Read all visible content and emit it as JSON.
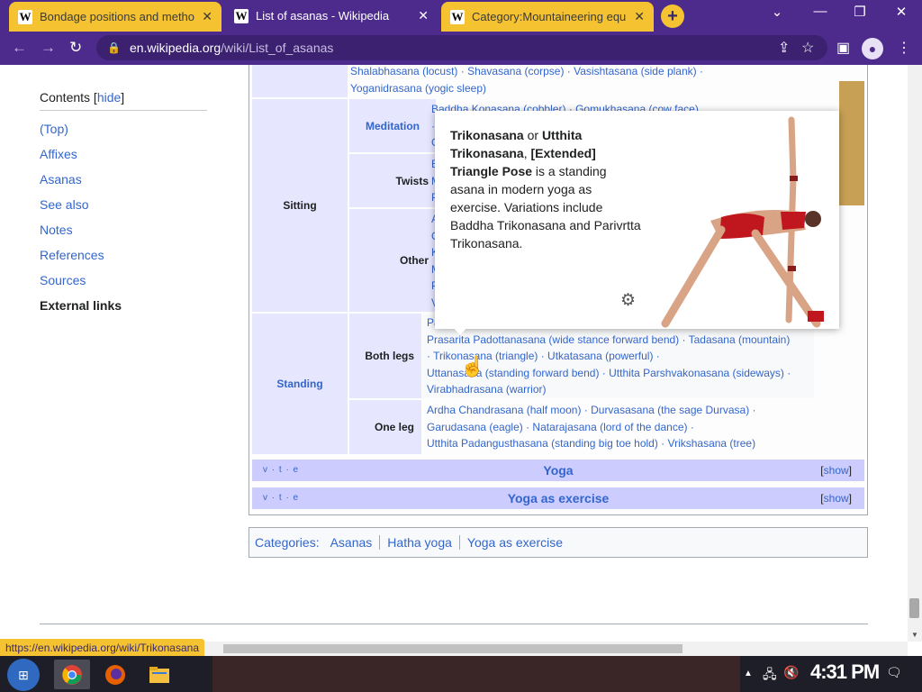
{
  "tabs": [
    {
      "title": "Bondage positions and methods",
      "favicon": "W"
    },
    {
      "title": "List of asanas - Wikipedia",
      "favicon": "W"
    },
    {
      "title": "Category:Mountaineering equip",
      "favicon": "W"
    }
  ],
  "address": {
    "host": "en.wikipedia.org",
    "path": "/wiki/List_of_asanas"
  },
  "toc": {
    "title": "Contents",
    "hide": "hide",
    "items": [
      "(Top)",
      "Affixes",
      "Asanas",
      "See also",
      "Notes",
      "References",
      "Sources",
      "External links"
    ]
  },
  "navbox": {
    "top_lines": [
      "Shalabhasana (locust) · Shavasana (corpse) · Vasishtasana (side plank) ·",
      "Yoganidrasana (yogic sleep)"
    ],
    "sitting": {
      "label": "Sitting",
      "meditation_label": "Meditation",
      "meditation_line": "Baddha Konasana (cobbler) · Gomukhasana (cow face) ·",
      "meditation_rest": [
        "G",
        "·"
      ],
      "twists_label": "Twists",
      "twists_rest": [
        "B",
        "M",
        "P"
      ],
      "other_label": "Other",
      "other_rest": [
        "A",
        "G",
        "K",
        "M",
        "P",
        "V"
      ]
    },
    "standing": {
      "label": "Standing",
      "both_label": "Both legs",
      "both_first": "Pa",
      "both_lines": [
        "Prasarita Padottanasana (wide stance forward bend) · Tadasana (mountain)",
        "· Trikonasana (triangle) · Utkatasana (powerful) ·",
        "Uttanasana (standing forward bend) · Utthita Parshvakonasana (sideways) ·",
        "Virabhadrasana (warrior)"
      ],
      "one_label": "One leg",
      "one_lines": [
        "Ardha Chandrasana (half moon) · Durvasasana (the sage Durvasa) ·",
        "Garudasana (eagle) · Natarajasana (lord of the dance) ·",
        "Utthita Padangusthasana (standing big toe hold) · Vrikshasana (tree)"
      ]
    },
    "footers": [
      {
        "vte": "v · t · e",
        "title": "Yoga",
        "show": "show"
      },
      {
        "vte": "v · t · e",
        "title": "Yoga as exercise",
        "show": "show"
      }
    ]
  },
  "categories": {
    "label": "Categories:",
    "items": [
      "Asanas",
      "Hatha yoga",
      "Yoga as exercise"
    ]
  },
  "preview": {
    "name": "Trikonasana",
    "or": " or ",
    "alt": "Utthita Trikonasana",
    "comma": ", ",
    "english": "[Extended] Triangle Pose",
    "rest": " is a standing asana in modern yoga as exercise. Variations include Baddha Trikonasana and Parivrtta Trikonasana."
  },
  "status_url": "https://en.wikipedia.org/wiki/Trikonasana",
  "clock": "4:31 PM",
  "colors": {
    "accent": "#4d2b8c",
    "tab": "#f5c332",
    "link": "#3366cc"
  }
}
